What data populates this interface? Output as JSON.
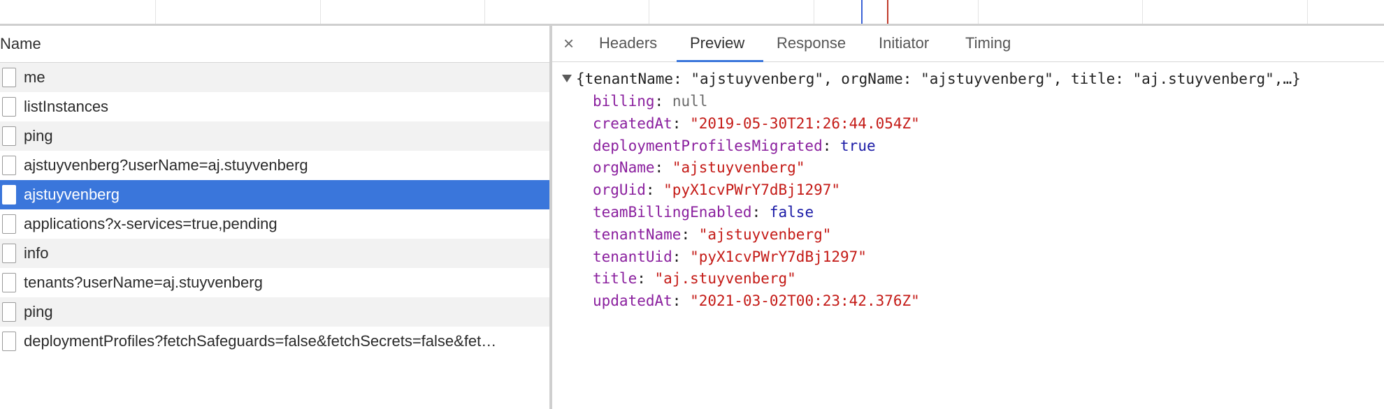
{
  "request_list": {
    "header": "Name",
    "rows": [
      {
        "label": "me",
        "selected": false
      },
      {
        "label": "listInstances",
        "selected": false
      },
      {
        "label": "ping",
        "selected": false
      },
      {
        "label": "ajstuyvenberg?userName=aj.stuyvenberg",
        "selected": false
      },
      {
        "label": "ajstuyvenberg",
        "selected": true
      },
      {
        "label": "applications?x-services=true,pending",
        "selected": false
      },
      {
        "label": "info",
        "selected": false
      },
      {
        "label": "tenants?userName=aj.stuyvenberg",
        "selected": false
      },
      {
        "label": "ping",
        "selected": false
      },
      {
        "label": "deploymentProfiles?fetchSafeguards=false&fetchSecrets=false&fet…",
        "selected": false
      }
    ]
  },
  "detail_tabs": {
    "close_glyph": "×",
    "tabs": [
      {
        "label": "Headers",
        "active": false
      },
      {
        "label": "Preview",
        "active": true
      },
      {
        "label": "Response",
        "active": false
      },
      {
        "label": "Initiator",
        "active": false
      },
      {
        "label": "Timing",
        "active": false
      }
    ]
  },
  "preview": {
    "summary": "{tenantName: \"ajstuyvenberg\", orgName: \"ajstuyvenberg\", title: \"aj.stuyvenberg\",…}",
    "properties": [
      {
        "key": "billing",
        "value": "null",
        "type": "null"
      },
      {
        "key": "createdAt",
        "value": "\"2019-05-30T21:26:44.054Z\"",
        "type": "string"
      },
      {
        "key": "deploymentProfilesMigrated",
        "value": "true",
        "type": "bool"
      },
      {
        "key": "orgName",
        "value": "\"ajstuyvenberg\"",
        "type": "string"
      },
      {
        "key": "orgUid",
        "value": "\"pyX1cvPWrY7dBj1297\"",
        "type": "string"
      },
      {
        "key": "teamBillingEnabled",
        "value": "false",
        "type": "bool"
      },
      {
        "key": "tenantName",
        "value": "\"ajstuyvenberg\"",
        "type": "string"
      },
      {
        "key": "tenantUid",
        "value": "\"pyX1cvPWrY7dBj1297\"",
        "type": "string"
      },
      {
        "key": "title",
        "value": "\"aj.stuyvenberg\"",
        "type": "string"
      },
      {
        "key": "updatedAt",
        "value": "\"2021-03-02T00:23:42.376Z\"",
        "type": "string"
      }
    ]
  },
  "colors": {
    "selection": "#3a76db",
    "json_key": "#8a1f9e",
    "json_string": "#c41a16",
    "json_bool": "#1a1aa6",
    "timeline_blue": "#3b63d6",
    "timeline_red": "#c03a2b"
  },
  "icons": {
    "row_icon": "document-icon",
    "expand_icon": "caret-down-icon",
    "close_icon": "close-icon"
  }
}
